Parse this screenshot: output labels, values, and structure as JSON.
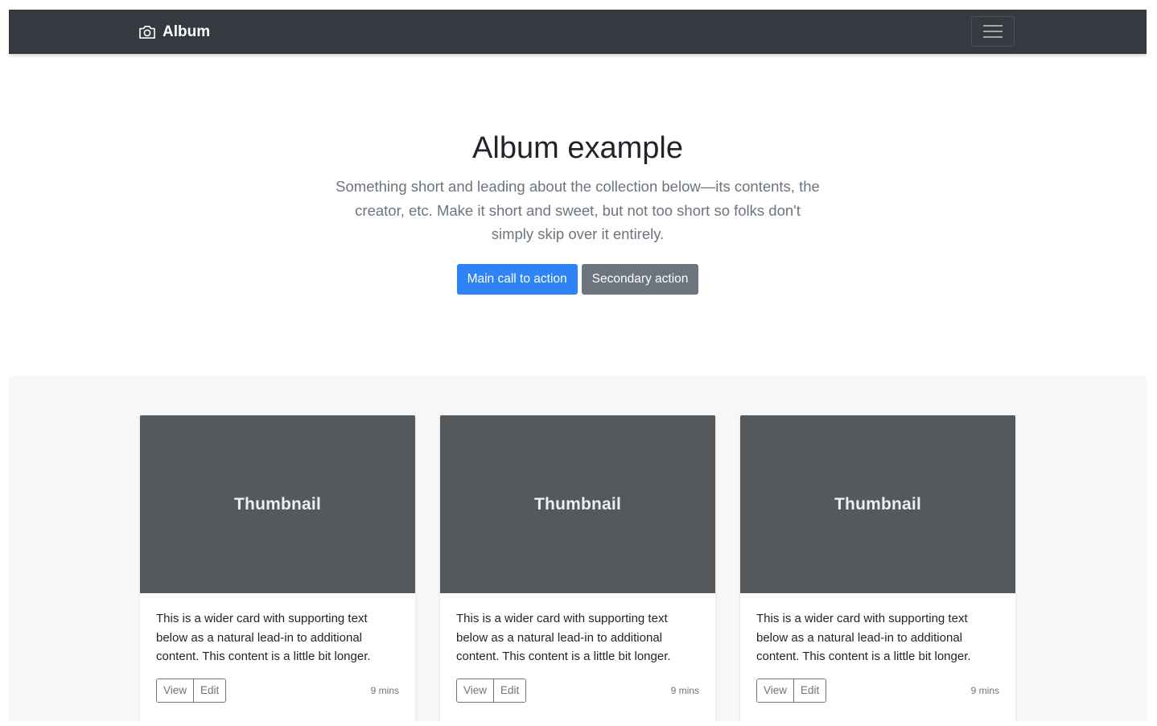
{
  "navbar": {
    "brand": "Album",
    "brand_icon": "camera-icon",
    "toggler_icon": "hamburger-icon",
    "background": "#343a40"
  },
  "hero": {
    "title": "Album example",
    "lead": "Something short and leading about the collection below—its contents, the creator, etc. Make it short and sweet, but not too short so folks don't simply skip over it entirely.",
    "primary_label": "Main call to action",
    "secondary_label": "Secondary action",
    "primary_color": "#2e84f6",
    "secondary_color": "#6c757d"
  },
  "cards": [
    {
      "thumbnail": "Thumbnail",
      "text": "This is a wider card with supporting text below as a natural lead-in to additional content. This content is a little bit longer.",
      "view_label": "View",
      "edit_label": "Edit",
      "time": "9 mins"
    },
    {
      "thumbnail": "Thumbnail",
      "text": "This is a wider card with supporting text below as a natural lead-in to additional content. This content is a little bit longer.",
      "view_label": "View",
      "edit_label": "Edit",
      "time": "9 mins"
    },
    {
      "thumbnail": "Thumbnail",
      "text": "This is a wider card with supporting text below as a natural lead-in to additional content. This content is a little bit longer.",
      "view_label": "View",
      "edit_label": "Edit",
      "time": "9 mins"
    }
  ]
}
